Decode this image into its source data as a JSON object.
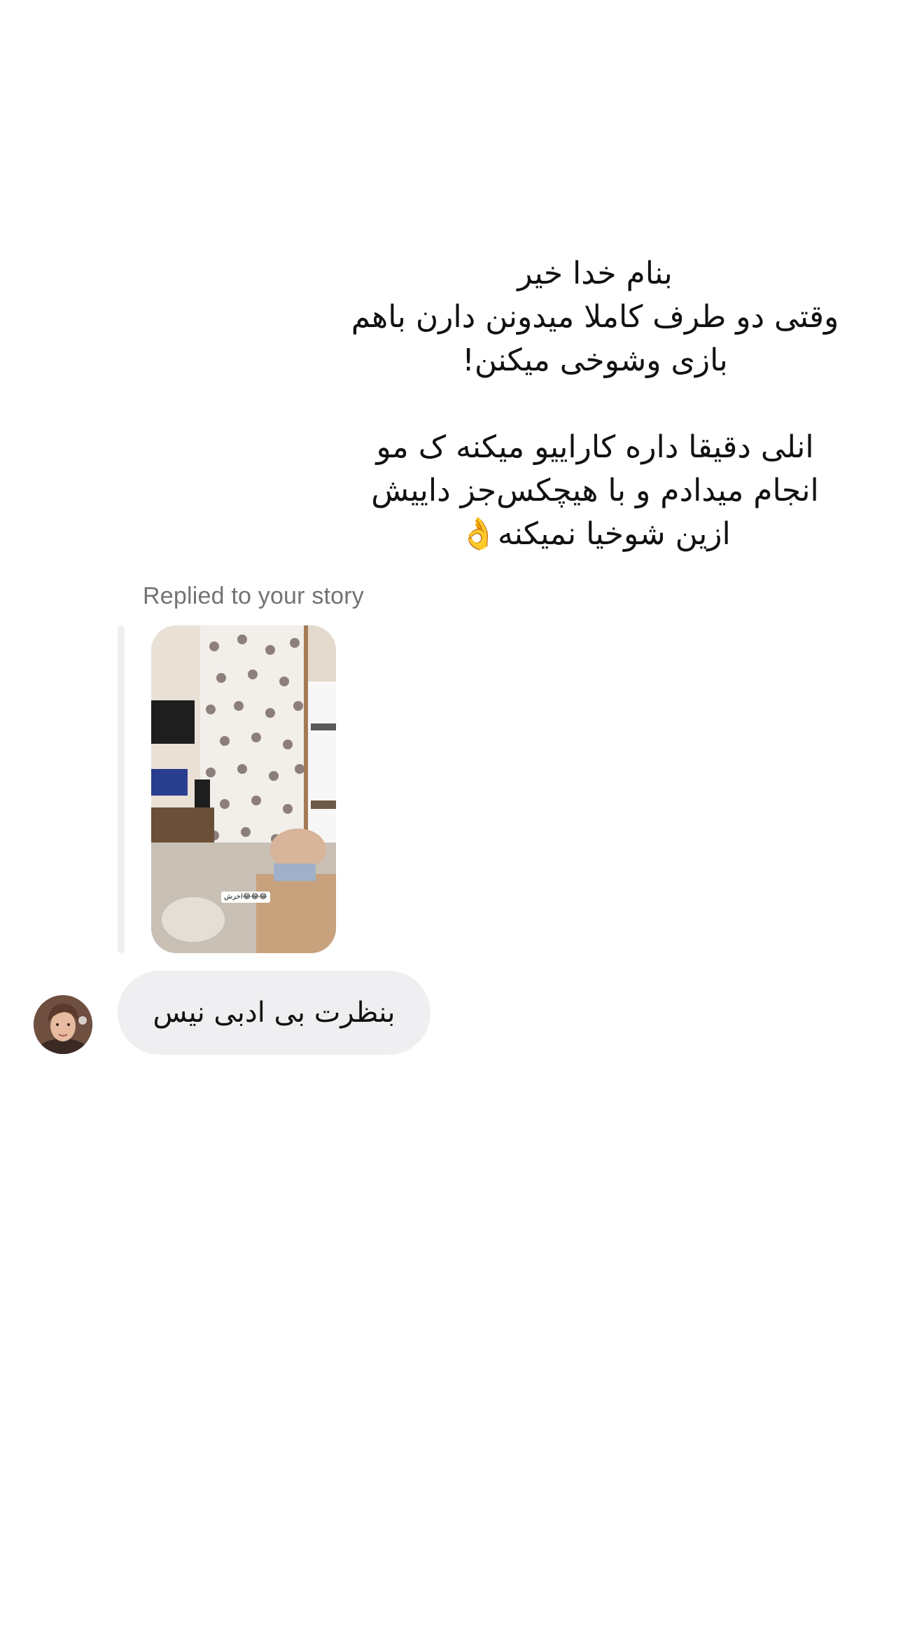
{
  "story_overlay": {
    "lines": [
      "بنام خدا خیر",
      "وقتی دو طرف کاملا میدونن دارن باهم",
      "بازی وشوخی میکنن!",
      "انلی دقیقا داره کاراییو میکنه ک مو",
      "انجام میدادم و با هیچکس‌جز داییش",
      "ازین شوخیا نمیکنه👌"
    ]
  },
  "reply": {
    "label": "Replied to your story",
    "story_sticker_text": "اخرش😂😂😂"
  },
  "message": {
    "text": "بنظرت بی ادبی نیس"
  },
  "colors": {
    "background": "#ffffff",
    "bubble": "#efeff1",
    "reply_bar": "#efefef",
    "label": "#737373",
    "text": "#111111"
  },
  "icons": {
    "avatar": "user-avatar-photo",
    "story": "story-thumbnail-image"
  }
}
